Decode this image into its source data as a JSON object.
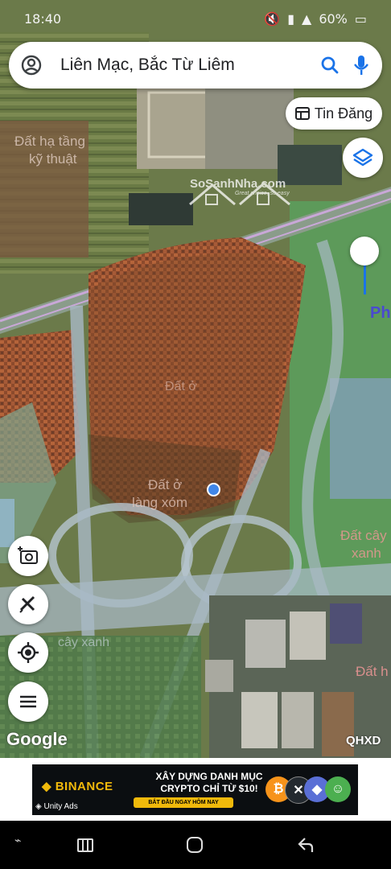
{
  "status_bar": {
    "time": "18:40",
    "battery": "60%"
  },
  "search": {
    "query": "Liên Mạc, Bắc Từ Liêm"
  },
  "tin_dang": {
    "label": "Tin Đăng"
  },
  "map": {
    "labels": {
      "top_left": "Đất hạ tầng kỹ thuật",
      "top_left_line1": "Đất hạ tầng",
      "top_left_line2": "kỹ thuật",
      "village_mid": "Đất ở",
      "village_line1": "Đất ở",
      "village_line2": "làng xóm",
      "right_green_line1": "Đất cây",
      "right_green_line2": "xanh",
      "left_green": "cây xanh",
      "bottom_right": "Đất h",
      "edge_right": "Ph"
    },
    "watermark": {
      "brand": "SoSanhNha.com",
      "tagline": "Great choice, so easy"
    }
  },
  "attribution": {
    "google": "Google",
    "layer": "QHXD"
  },
  "ad": {
    "brand": "BINANCE",
    "headline_line1": "XÂY DỰNG DANH MỤC",
    "headline_line2": "CRYPTO CHỈ TỪ $10!",
    "cta": "BẮT ĐẦU NGAY HÔM NAY",
    "network": "Unity Ads"
  },
  "colors": {
    "accent_blue": "#1a73e8",
    "location_dot": "#3f86e8",
    "binance_yellow": "#f0b90b"
  }
}
